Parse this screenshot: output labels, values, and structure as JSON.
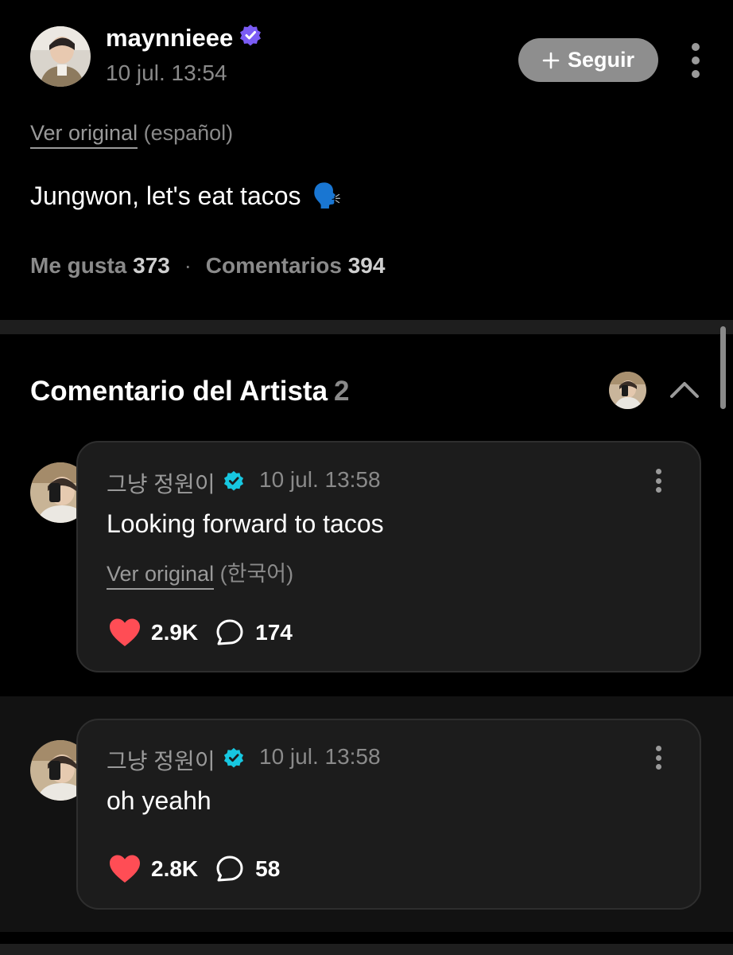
{
  "post": {
    "username": "maynnieee",
    "date": "10 jul. 13:54",
    "follow_label": "Seguir",
    "ver_original": "Ver original",
    "original_lang": "(español)",
    "text": "Jungwon, let's eat tacos",
    "text_emoji": "🗣️",
    "likes_label": "Me gusta",
    "likes_count": "373",
    "comments_label": "Comentarios",
    "comments_count": "394"
  },
  "artist_section": {
    "title": "Comentario del Artista",
    "count": "2"
  },
  "comments": [
    {
      "author": "그냥 정원이",
      "date": "10 jul. 13:58",
      "text": "Looking forward to tacos",
      "ver_original": "Ver original",
      "original_lang": "(한국어)",
      "likes": "2.9K",
      "replies": "174"
    },
    {
      "author": "그냥 정원이",
      "date": "10 jul. 13:58",
      "text": "oh yeahh",
      "likes": "2.8K",
      "replies": "58"
    }
  ],
  "colors": {
    "verified_purple": "#7b5cf5",
    "verified_teal": "#17c7e0",
    "heart_red": "#ff4d55",
    "follow_button": "#8e8e8e"
  }
}
